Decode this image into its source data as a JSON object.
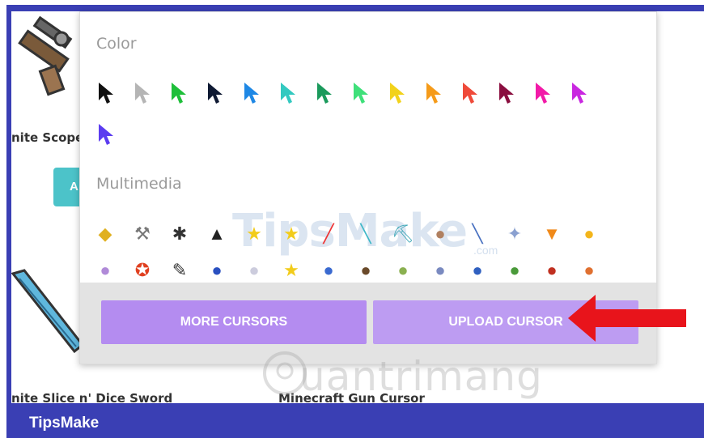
{
  "background": {
    "item1_title": "nite Scope",
    "item1_button": "A",
    "item2_title": "nite Slice n' Dice Sword",
    "item3_title": "Minecraft Gun Cursor"
  },
  "popup": {
    "color_section": "Color",
    "multimedia_section": "Multimedia",
    "cursor_colors": [
      "#111111",
      "#b5b5b5",
      "#1fbf3a",
      "#0f1a33",
      "#1e88e5",
      "#33c9c0",
      "#1b9a5c",
      "#3fe07a",
      "#f2d21b",
      "#f59b1a",
      "#ef4a3a",
      "#8a0e3f",
      "#f21aa8",
      "#c927e0",
      "#5b3cf0"
    ],
    "multimedia_icons_row1": [
      "wolverine-icon",
      "thor-hammer-icon",
      "spider-icon",
      "batman-icon",
      "pikachu-icon",
      "pikachu-icon",
      "lightsaber-icon",
      "minecraft-sword-icon",
      "minecraft-pickaxe-icon",
      "gremlin-icon",
      "knife-icon",
      "robot-icon",
      "pizza-icon",
      "jake-icon"
    ],
    "multimedia_icons_row2": [
      "lumpy-space-icon",
      "rebel-icon",
      "pen-icon",
      "sonic-icon",
      "ghost-icon",
      "pikachu-icon",
      "stitch-icon",
      "mr-t-icon",
      "yoda-icon",
      "mouse-icon",
      "captain-america-icon",
      "hulk-icon",
      "iron-man-icon",
      "iron-man-2-icon"
    ],
    "more_cursors": "MORE CURSORS",
    "upload_cursor": "UPLOAD CURSOR"
  },
  "watermarks": {
    "tipsmake": "TipsMake",
    "tipsmake_sub": ".com",
    "quantrimang": "uantrimang"
  },
  "footer": {
    "brand": "TipsMake"
  },
  "colors": {
    "frame": "#3a3fb4",
    "button_purple": "#b48cf0",
    "arrow_red": "#e8141b"
  }
}
